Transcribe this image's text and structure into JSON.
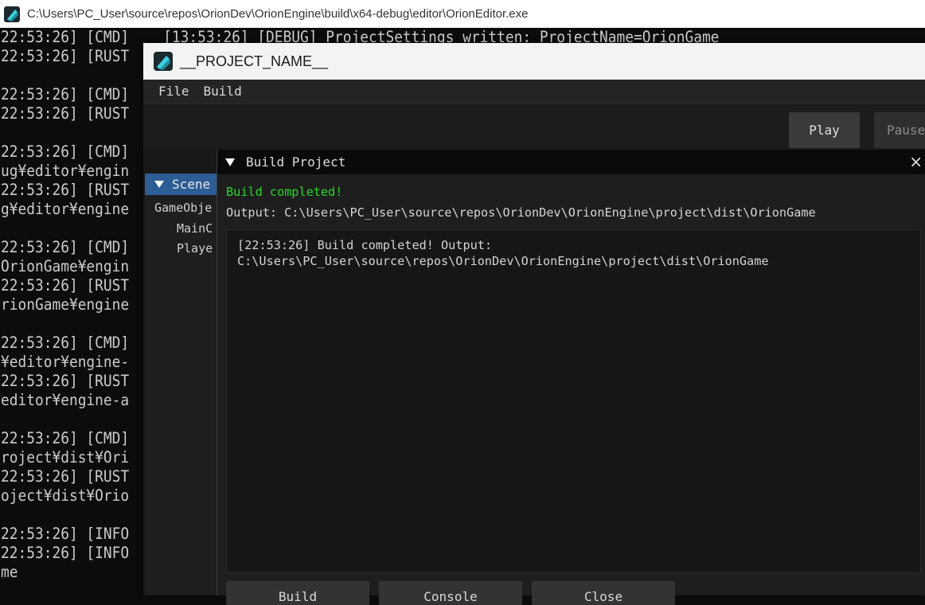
{
  "console": {
    "title": "C:\\Users\\PC_User\\source\\repos\\OrionDev\\OrionEngine\\build\\x64-debug\\editor\\OrionEditor.exe",
    "icon": "orion-logo-icon",
    "lines": [
      "22:53:26] [CMD]    [13:53:26] [DEBUG] ProjectSettings written: ProjectName=OrionGame",
      "22:53:26] [RUST",
      "",
      "22:53:26] [CMD]",
      "22:53:26] [RUST",
      "",
      "22:53:26] [CMD]",
      "ug¥editor¥engin",
      "22:53:26] [RUST",
      "g¥editor¥engine",
      "",
      "22:53:26] [CMD]",
      "OrionGame¥engin",
      "22:53:26] [RUST",
      "rionGame¥engine",
      "",
      "22:53:26] [CMD]",
      "¥editor¥engine-",
      "22:53:26] [RUST",
      "editor¥engine-a",
      "",
      "22:53:26] [CMD]",
      "roject¥dist¥Ori",
      "22:53:26] [RUST",
      "oject¥dist¥Orio",
      "",
      "22:53:26] [INFO",
      "22:53:26] [INFO",
      "me"
    ]
  },
  "editor": {
    "title": "__PROJECT_NAME__",
    "icon": "orion-logo-icon",
    "menu": [
      "File",
      "Build"
    ],
    "toolbar": {
      "play_label": "Play",
      "pause_label": "Pause"
    },
    "scene": {
      "tab_label": "Scene",
      "header": "GameObje",
      "items": [
        "MainC",
        "Playe"
      ]
    }
  },
  "build_modal": {
    "title": "Build Project",
    "close_glyph": "×",
    "status": "Build completed!",
    "output_line": "Output: C:\\Users\\PC_User\\source\\repos\\OrionDev\\OrionEngine\\project\\dist\\OrionGame",
    "log": [
      "[22:53:26] Build completed! Output:",
      "C:\\Users\\PC_User\\source\\repos\\OrionDev\\OrionEngine\\project\\dist\\OrionGame"
    ],
    "buttons": {
      "build": "Build",
      "console": "Console",
      "close": "Close"
    },
    "colors": {
      "success": "#26d826",
      "accent": "#2c5d95"
    }
  }
}
